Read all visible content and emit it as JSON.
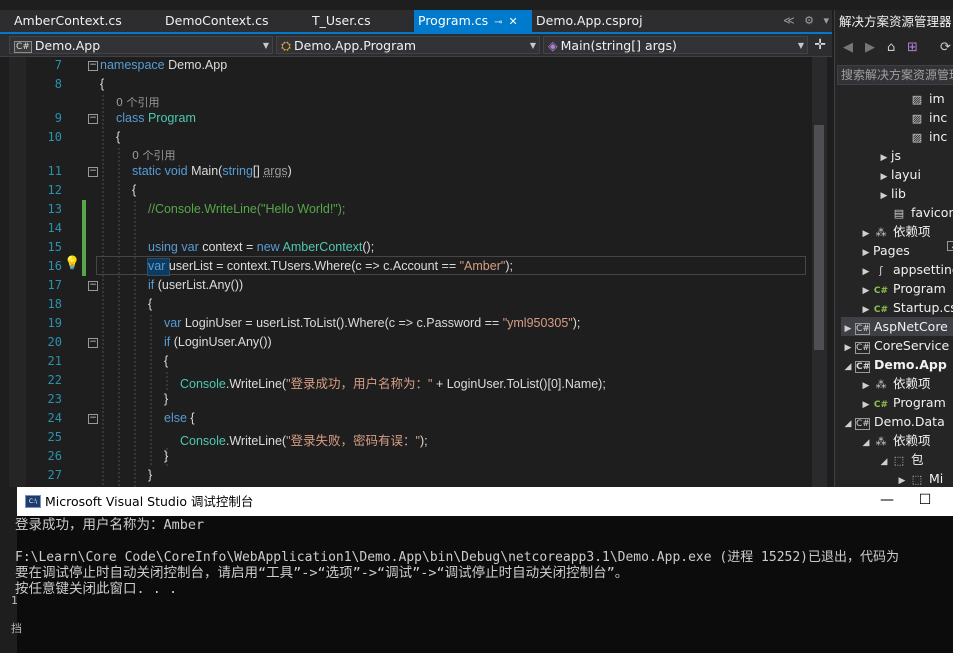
{
  "tabs": [
    {
      "label": "AmberContext.cs",
      "active": false
    },
    {
      "label": "DemoContext.cs",
      "active": false
    },
    {
      "label": "T_User.cs",
      "active": false
    },
    {
      "label": "Program.cs",
      "active": true,
      "pin": "⊸",
      "close": "✕"
    },
    {
      "label": "Demo.App.csproj",
      "active": false
    }
  ],
  "tab_controls": {
    "scroll_left": "≪",
    "settings": "⚙",
    "dropdown": "▾"
  },
  "navbar": {
    "project": "Demo.App",
    "type": "Demo.App.Program",
    "member": "Main(string[] args)",
    "project_icon": "C#",
    "split": "✛"
  },
  "editor": {
    "line_numbers": [
      "7",
      "8",
      "9",
      "10",
      "11",
      "12",
      "13",
      "14",
      "15",
      "16",
      "17",
      "18",
      "19",
      "20",
      "21",
      "22",
      "23",
      "24",
      "25",
      "26",
      "27"
    ],
    "codelens": [
      "0 个引用",
      "0 个引用"
    ],
    "lines": {
      "l7_kw": "namespace",
      "l7_rest": " Demo.App",
      "l8": "{",
      "l9_kw": "class",
      "l9_ty": " Program",
      "l10": "{",
      "l11_kw1": "static",
      "l11_kw2": " void",
      "l11_name": " Main(",
      "l11_kw3": "string",
      "l11_rest": "[] ",
      "l11_param": "args",
      "l11_close": ")",
      "l12": "{",
      "l13": "//Console.WriteLine(\"Hello World!\");",
      "l15_kw1": "using",
      "l15_kw2": " var",
      "l15_mid": " context = ",
      "l15_kw3": "new",
      "l15_ty": " AmberContext",
      "l15_end": "();",
      "l16_kw": "var",
      "l16_mid": " userList = context.TUsers.Where(c => c.Account == ",
      "l16_str": "\"Amber\"",
      "l16_end": ");",
      "l17_kw": "if",
      "l17_rest": " (userList.Any())",
      "l18": "{",
      "l19_kw": "var",
      "l19_mid": " LoginUser = userList.ToList().Where(c => c.Password == ",
      "l19_str": "\"yml950305\"",
      "l19_end": ");",
      "l20_kw": "if",
      "l20_rest": " (LoginUser.Any())",
      "l21": "{",
      "l22_ty": "Console",
      "l22_mid": ".WriteLine(",
      "l22_str": "\"登录成功，用户名称为：\"",
      "l22_end": " + LoginUser.ToList()[0].Name);",
      "l23": "}",
      "l24_kw": "else",
      "l24_rest": " {",
      "l25_ty": "Console",
      "l25_mid": ".WriteLine(",
      "l25_str": "\"登录失败，密码有误：\"",
      "l25_end": ");",
      "l26": "}",
      "l27": "}"
    }
  },
  "solution_explorer": {
    "title": "解决方案资源管理器",
    "search_placeholder": "搜索解决方案资源管理器",
    "toolbar": [
      "◀",
      "▶",
      "⌂",
      "⊞",
      "⟳"
    ],
    "items": [
      {
        "label": "im",
        "icon": "img",
        "arrow": ""
      },
      {
        "label": "inc",
        "icon": "img",
        "arrow": ""
      },
      {
        "label": "inc",
        "icon": "img",
        "arrow": ""
      },
      {
        "label": "js",
        "icon": "folder",
        "arrow": "▶"
      },
      {
        "label": "layui",
        "icon": "folder",
        "arrow": "▶"
      },
      {
        "label": "lib",
        "icon": "folder",
        "arrow": "▶"
      },
      {
        "label": "favicon",
        "icon": "file",
        "arrow": ""
      },
      {
        "label": "依赖项",
        "icon": "dep",
        "arrow": "▶"
      },
      {
        "label": "Pages",
        "icon": "folder",
        "arrow": "▶"
      },
      {
        "label": "appsettings",
        "icon": "json",
        "arrow": "▶"
      },
      {
        "label": "Program",
        "icon": "csfile",
        "arrow": "▶"
      },
      {
        "label": "Startup.cs",
        "icon": "csfile",
        "arrow": "▶"
      },
      {
        "label": "AspNetCore",
        "icon": "csproj",
        "arrow": "▶",
        "selected": true
      },
      {
        "label": "CoreService",
        "icon": "csproj",
        "arrow": "▶"
      },
      {
        "label": "Demo.App",
        "icon": "csproj",
        "arrow": "◢",
        "bold": true
      },
      {
        "label": "依赖项",
        "icon": "dep",
        "arrow": "▶"
      },
      {
        "label": "Program",
        "icon": "csfile",
        "arrow": "▶"
      },
      {
        "label": "Demo.Data",
        "icon": "csproj",
        "arrow": "◢"
      },
      {
        "label": "依赖项",
        "icon": "dep",
        "arrow": "◢"
      },
      {
        "label": "包",
        "icon": "pkg",
        "arrow": "◢"
      },
      {
        "label": "Mi",
        "icon": "pkg",
        "arrow": "▶"
      }
    ]
  },
  "console": {
    "title": "Microsoft Visual Studio 调试控制台",
    "icon_text": "C:\\",
    "minimize": "—",
    "maximize": "☐",
    "lines": [
      "登录成功，用户名称为：Amber",
      "",
      "F:\\Learn\\Core Code\\CoreInfo\\WebApplication1\\Demo.App\\bin\\Debug\\netcoreapp3.1\\Demo.App.exe (进程 15252)已退出，代码为",
      "要在调试停止时自动关闭控制台，请启用“工具”->“选项”->“调试”->“调试停止时自动关闭控制台”。",
      "按任意键关闭此窗口. . ."
    ],
    "strip_marks": [
      "1",
      "挡"
    ]
  }
}
